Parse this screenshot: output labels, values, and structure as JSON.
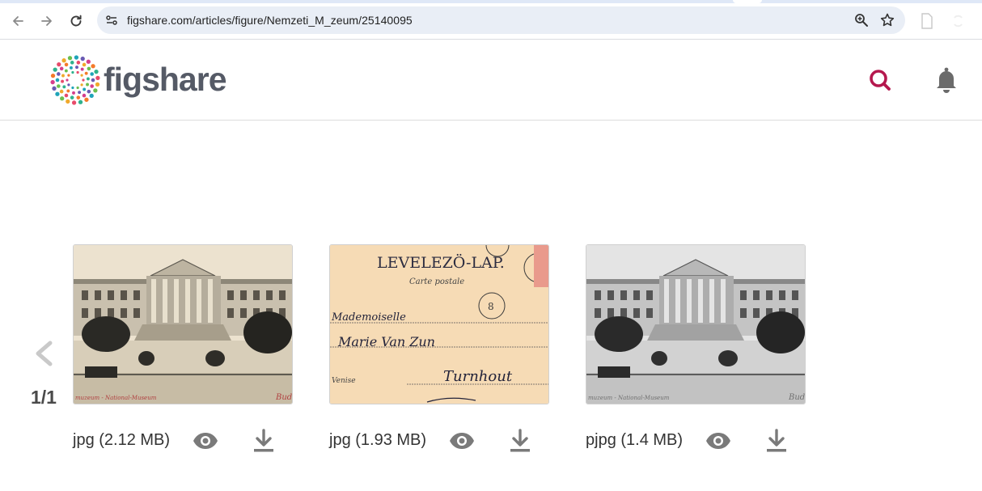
{
  "browser": {
    "url": "figshare.com/articles/figure/Nemzeti_M_zeum/25140095",
    "icons": [
      "back-arrow-icon",
      "forward-arrow-icon",
      "reload-icon",
      "site-info-icon",
      "zoom-icon",
      "bookmark-star-icon",
      "extension-icon"
    ]
  },
  "header": {
    "logo_text": "figshare",
    "icons": [
      "search-icon",
      "notification-bell-icon"
    ],
    "accent_color": "#b5184e"
  },
  "carousel": {
    "pager": "1/1",
    "items": [
      {
        "file": "jpg (2.12 MB)",
        "caption_left": "muzeum - National-Museum",
        "caption_right": "Bud",
        "tone": "sepia"
      },
      {
        "file": "jpg (1.93 MB)",
        "heading": "LEVELEZÖ-LAP.",
        "sub": "Carte postale",
        "line1": "Mademoiselle",
        "line2": "Marie Van Zun",
        "line3": "Turnhout",
        "line4": "Venise",
        "tone": "cream"
      },
      {
        "file": "pjpg (1.4 MB)",
        "caption_left": "muzeum - National-Museum",
        "caption_right": "Bud",
        "tone": "gray"
      }
    ]
  }
}
